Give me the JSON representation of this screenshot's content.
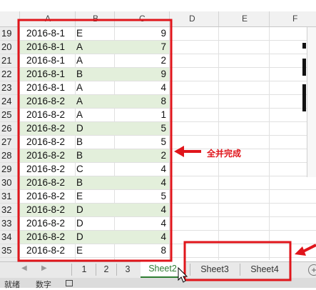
{
  "columns": [
    "A",
    "B",
    "C",
    "D",
    "E",
    "F"
  ],
  "rows": [
    {
      "n": "19",
      "a": "2016-8-1",
      "b": "E",
      "c": "9"
    },
    {
      "n": "20",
      "a": "2016-8-1",
      "b": "A",
      "c": "7"
    },
    {
      "n": "21",
      "a": "2016-8-1",
      "b": "A",
      "c": "2"
    },
    {
      "n": "22",
      "a": "2016-8-1",
      "b": "B",
      "c": "9"
    },
    {
      "n": "23",
      "a": "2016-8-1",
      "b": "A",
      "c": "4"
    },
    {
      "n": "24",
      "a": "2016-8-2",
      "b": "A",
      "c": "8"
    },
    {
      "n": "25",
      "a": "2016-8-2",
      "b": "A",
      "c": "1"
    },
    {
      "n": "26",
      "a": "2016-8-2",
      "b": "D",
      "c": "5"
    },
    {
      "n": "27",
      "a": "2016-8-2",
      "b": "B",
      "c": "5"
    },
    {
      "n": "28",
      "a": "2016-8-2",
      "b": "B",
      "c": "2"
    },
    {
      "n": "29",
      "a": "2016-8-2",
      "b": "C",
      "c": "4"
    },
    {
      "n": "30",
      "a": "2016-8-2",
      "b": "B",
      "c": "4"
    },
    {
      "n": "31",
      "a": "2016-8-2",
      "b": "E",
      "c": "5"
    },
    {
      "n": "32",
      "a": "2016-8-2",
      "b": "D",
      "c": "4"
    },
    {
      "n": "33",
      "a": "2016-8-2",
      "b": "D",
      "c": "4"
    },
    {
      "n": "34",
      "a": "2016-8-2",
      "b": "D",
      "c": "4"
    },
    {
      "n": "35",
      "a": "2016-8-2",
      "b": "E",
      "c": "8"
    }
  ],
  "annotation": {
    "text": "全并完成",
    "color": "#e0151b"
  },
  "sheets": [
    {
      "label": "1",
      "active": false
    },
    {
      "label": "2",
      "active": false
    },
    {
      "label": "3",
      "active": false
    },
    {
      "label": "Sheet2",
      "active": true
    },
    {
      "label": "Sheet3",
      "active": false
    },
    {
      "label": "Sheet4",
      "active": false
    }
  ],
  "add_sheet_icon": "plus-circle-icon",
  "status": {
    "mode": "就绪",
    "numlock": "数字"
  },
  "colors": {
    "band": "#e3efdb",
    "highlight": "#e0151b",
    "active_tab": "#2e7d32"
  }
}
